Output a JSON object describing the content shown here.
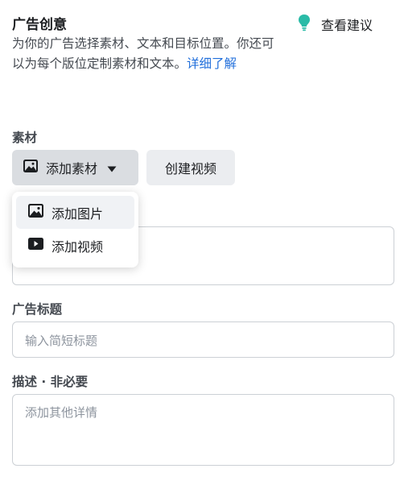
{
  "header": {
    "title": "广告创意",
    "tips_label": "查看建议",
    "description": "为你的广告选择素材、文本和目标位置。你还可以为每个版位定制素材和文本。",
    "learn_more": "详细了解"
  },
  "media": {
    "label": "素材",
    "add_button": "添加素材",
    "create_video_button": "创建视频",
    "menu": [
      {
        "label": "添加图片",
        "icon": "image-icon"
      },
      {
        "label": "添加视频",
        "icon": "video-icon"
      }
    ]
  },
  "headline": {
    "label": "广告标题",
    "placeholder": "输入简短标题"
  },
  "description_field": {
    "label": "描述 · 非必要",
    "placeholder": "添加其他详情"
  },
  "colors": {
    "accent": "#216fdb",
    "bulb": "#2abba7",
    "icon_dark": "#1c1e21"
  }
}
